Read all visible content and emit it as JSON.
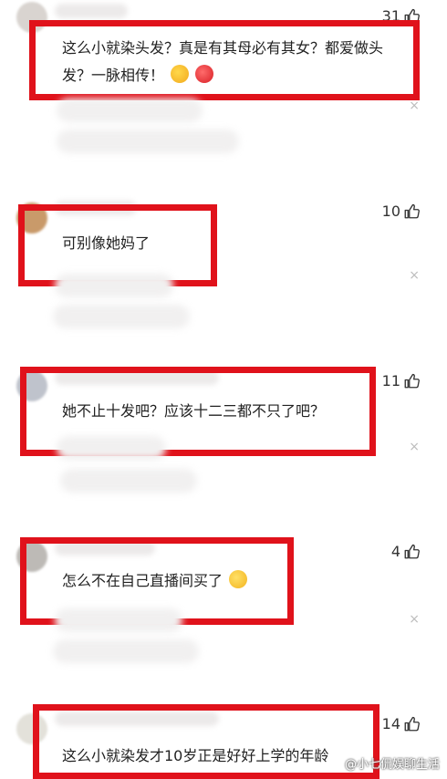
{
  "comments": [
    {
      "likes": "31",
      "text_line1": "这么小就染头发？真是有其母必有其女？都爱做头",
      "text_line2": "发？一脉相传！",
      "emojis": [
        "thinking-face-emoji",
        "angry-face-emoji"
      ]
    },
    {
      "likes": "10",
      "text": "可别像她妈了"
    },
    {
      "likes": "11",
      "text": "她不止十发吧？应该十二三都不只了吧？"
    },
    {
      "likes": "4",
      "text": "怎么不在自己直播间买了",
      "emojis": [
        "crying-laughing-emoji"
      ]
    },
    {
      "likes": "14",
      "text": "这么小就染发才10岁正是好好上学的年龄"
    }
  ],
  "close_symbol": "×",
  "watermark": "@小七侃娱聊生活",
  "colors": {
    "highlight_box": "#e0121b",
    "text": "#222222",
    "close": "#bdbdbd"
  }
}
